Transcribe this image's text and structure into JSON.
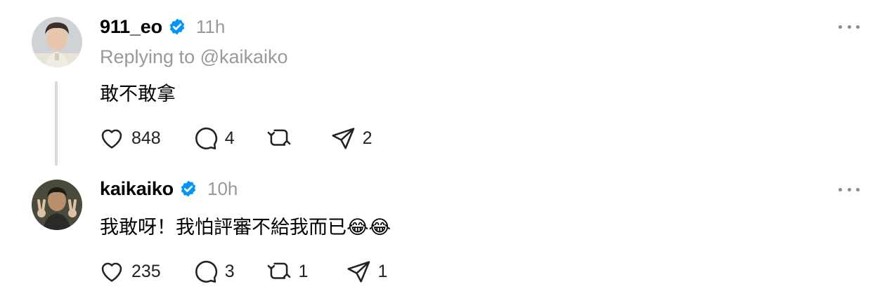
{
  "posts": [
    {
      "username": "911_eo",
      "time": "11h",
      "reply_to": "Replying to @kaikaiko",
      "text": "敢不敢拿",
      "emoji": "",
      "likes": "848",
      "comments": "4",
      "reposts": "",
      "shares": "2"
    },
    {
      "username": "kaikaiko",
      "time": "10h",
      "reply_to": "",
      "text": "我敢呀！我怕評審不給我而已",
      "emoji": "😂😂",
      "likes": "235",
      "comments": "3",
      "reposts": "1",
      "shares": "1"
    }
  ],
  "colors": {
    "verified_badge": "#0095f6",
    "secondary_text": "#999999",
    "thread_line": "#d9d9d9"
  },
  "icons": [
    "heart-icon",
    "comment-icon",
    "repost-icon",
    "share-icon",
    "more-icon",
    "verified-badge-icon"
  ]
}
